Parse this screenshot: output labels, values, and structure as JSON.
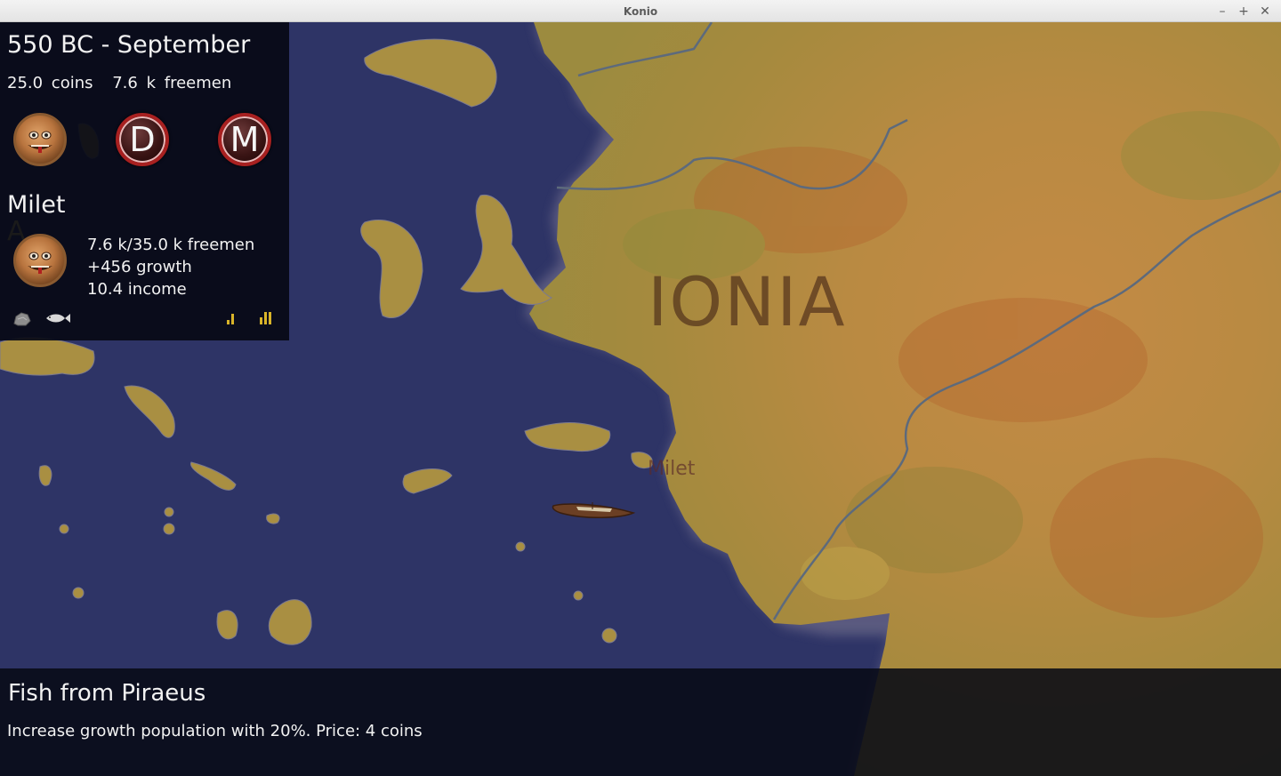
{
  "window": {
    "title": "Konio",
    "minimize": "–",
    "maximize": "+",
    "close": "✕"
  },
  "map": {
    "region_label": "IONIA",
    "city_label": "Milet"
  },
  "status_panel": {
    "date": "550 BC - September",
    "coins": "25.0 coins",
    "freemen": "7.6 k freemen",
    "buttons": [
      {
        "name": "gorgon-emblem",
        "label": ""
      },
      {
        "name": "d-button",
        "label": "D"
      },
      {
        "name": "m-button",
        "label": "M"
      }
    ]
  },
  "city_panel": {
    "name": "Milet",
    "overlap_letter": "A",
    "population": "7.6 k/35.0 k freemen",
    "growth": "+456 growth",
    "income": "10.4 income",
    "resources": [
      "stone-icon",
      "fish-icon"
    ],
    "bar_levels": [
      2,
      3
    ]
  },
  "tooltip": {
    "title": "Fish from Piraeus",
    "description": "Increase growth population with 20%. Price: 4 coins"
  },
  "colors": {
    "sea": "#2e3466",
    "land": "#b8873d",
    "panel": "#080a16",
    "bar": "#d9b429",
    "button_ring": "#a82020"
  }
}
